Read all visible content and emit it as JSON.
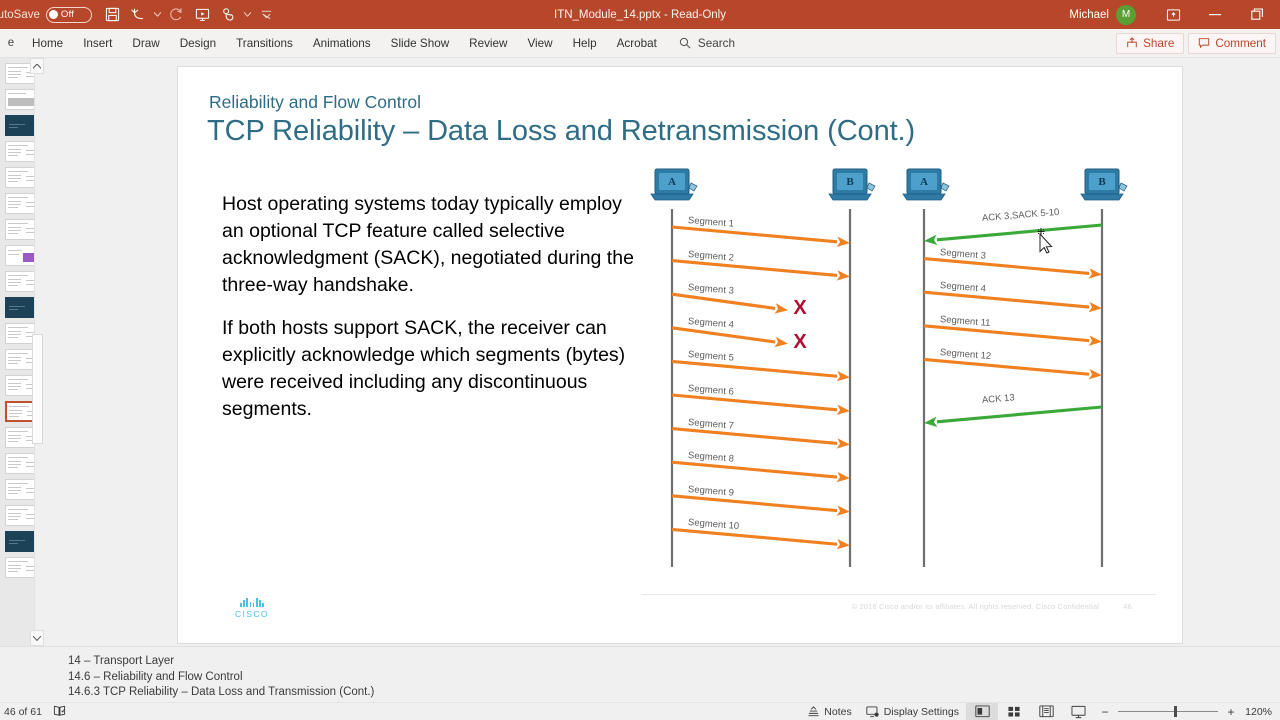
{
  "titlebar": {
    "autosave_label": "AutoSave",
    "autosave_state": "Off",
    "document_title": "ITN_Module_14.pptx  -  Read-Only",
    "user_name": "Michael",
    "avatar_initial": "M",
    "qat": [
      {
        "name": "save-icon",
        "label": "Save"
      },
      {
        "name": "undo-icon",
        "label": "Undo"
      },
      {
        "name": "redo-icon",
        "label": "Redo"
      },
      {
        "name": "start-presentation-icon",
        "label": "Start From Beginning"
      },
      {
        "name": "touch-mode-icon",
        "label": "Touch/Mouse Mode"
      },
      {
        "name": "customize-qat-icon",
        "label": "Customize Quick Access Toolbar"
      }
    ],
    "window_buttons": [
      {
        "name": "ribbon-display-options-icon",
        "label": "Ribbon Display Options"
      },
      {
        "name": "minimize-icon",
        "label": "Minimize"
      },
      {
        "name": "restore-icon",
        "label": "Restore Down"
      }
    ]
  },
  "ribbon": {
    "file_tab": "e",
    "tabs": [
      {
        "label": "Home",
        "active": true
      },
      {
        "label": "Insert",
        "active": false
      },
      {
        "label": "Draw",
        "active": false
      },
      {
        "label": "Design",
        "active": false
      },
      {
        "label": "Transitions",
        "active": false
      },
      {
        "label": "Animations",
        "active": false
      },
      {
        "label": "Slide Show",
        "active": false
      },
      {
        "label": "Review",
        "active": false
      },
      {
        "label": "View",
        "active": false
      },
      {
        "label": "Help",
        "active": false
      },
      {
        "label": "Acrobat",
        "active": false
      }
    ],
    "search_placeholder": "Search",
    "share_label": "Share",
    "comments_label": "Comment"
  },
  "slide": {
    "eyebrow": "Reliability and Flow Control",
    "title": "TCP Reliability – Data Loss and Retransmission (Cont.)",
    "paragraphs": [
      "Host operating systems today typically employ an optional TCP feature called selective acknowledgment (SACK), negotiated during the three-way handshake.",
      "If both hosts support SACK, the receiver can explicitly acknowledge which segments (bytes) were received including any discontinuous segments."
    ],
    "cisco_logo_word": "CISCO",
    "copyright": "© 2016  Cisco and/or its affiliates. All rights reserved.   Cisco Confidential",
    "page_number": "46",
    "colors": {
      "title": "#2f6c86",
      "segment_arrow": "#f08020",
      "ack_arrow": "#3aa93a",
      "loss_mark": "#b01030",
      "host_body": "#2e7ba6"
    },
    "diagram_left": {
      "host_a_label": "A",
      "host_b_label": "B",
      "messages": [
        {
          "label": "Segment 1",
          "dir": "right",
          "kind": "segment",
          "lost": false
        },
        {
          "label": "Segment 2",
          "dir": "right",
          "kind": "segment",
          "lost": false
        },
        {
          "label": "Segment 3",
          "dir": "right",
          "kind": "segment",
          "lost": true
        },
        {
          "label": "Segment 4",
          "dir": "right",
          "kind": "segment",
          "lost": true
        },
        {
          "label": "Segment 5",
          "dir": "right",
          "kind": "segment",
          "lost": false
        },
        {
          "label": "Segment 6",
          "dir": "right",
          "kind": "segment",
          "lost": false
        },
        {
          "label": "Segment 7",
          "dir": "right",
          "kind": "segment",
          "lost": false
        },
        {
          "label": "Segment 8",
          "dir": "right",
          "kind": "segment",
          "lost": false
        },
        {
          "label": "Segment 9",
          "dir": "right",
          "kind": "segment",
          "lost": false
        },
        {
          "label": "Segment 10",
          "dir": "right",
          "kind": "segment",
          "lost": false
        }
      ]
    },
    "diagram_right": {
      "host_a_label": "A",
      "host_b_label": "B",
      "messages": [
        {
          "label": "ACK 3,SACK 5-10",
          "dir": "left",
          "kind": "ack",
          "lost": false
        },
        {
          "label": "Segment 3",
          "dir": "right",
          "kind": "segment",
          "lost": false
        },
        {
          "label": "Segment 4",
          "dir": "right",
          "kind": "segment",
          "lost": false
        },
        {
          "label": "Segment 11",
          "dir": "right",
          "kind": "segment",
          "lost": false
        },
        {
          "label": "Segment 12",
          "dir": "right",
          "kind": "segment",
          "lost": false
        },
        {
          "label": "ACK 13",
          "dir": "left",
          "kind": "ack",
          "lost": false
        }
      ]
    }
  },
  "notes": {
    "lines": [
      "14 – Transport Layer",
      "14.6 – Reliability and Flow Control",
      "14.6.3 TCP Reliability – Data Loss and Transmission (Cont.)"
    ]
  },
  "statusbar": {
    "slide_counter": "46 of 61",
    "accessibility_label": "Accessibility Checker",
    "notes_label": "Notes",
    "display_settings_label": "Display Settings",
    "views": [
      {
        "name": "normal-view-button",
        "active": true
      },
      {
        "name": "slide-sorter-view-button",
        "active": false
      },
      {
        "name": "reading-view-button",
        "active": false
      },
      {
        "name": "slide-show-button",
        "active": false
      }
    ],
    "zoom_out": "−",
    "zoom_in": "+",
    "zoom_level": "120%"
  },
  "thumbnails": [
    {
      "index": 1,
      "style": "text",
      "selected": false
    },
    {
      "index": 2,
      "style": "bars",
      "selected": false
    },
    {
      "index": 3,
      "style": "dark",
      "selected": false
    },
    {
      "index": 4,
      "style": "text",
      "selected": false
    },
    {
      "index": 5,
      "style": "text",
      "selected": false
    },
    {
      "index": 6,
      "style": "text",
      "selected": false
    },
    {
      "index": 7,
      "style": "text",
      "selected": false
    },
    {
      "index": 8,
      "style": "purple",
      "selected": false
    },
    {
      "index": 9,
      "style": "text",
      "selected": false
    },
    {
      "index": 10,
      "style": "dark",
      "selected": false
    },
    {
      "index": 11,
      "style": "text",
      "selected": false
    },
    {
      "index": 12,
      "style": "text",
      "selected": false
    },
    {
      "index": 13,
      "style": "text",
      "selected": false
    },
    {
      "index": 14,
      "style": "text",
      "selected": true
    },
    {
      "index": 15,
      "style": "text",
      "selected": false
    },
    {
      "index": 16,
      "style": "text",
      "selected": false
    },
    {
      "index": 17,
      "style": "text",
      "selected": false
    },
    {
      "index": 18,
      "style": "text",
      "selected": false
    },
    {
      "index": 19,
      "style": "dark",
      "selected": false
    },
    {
      "index": 20,
      "style": "text",
      "selected": false
    }
  ]
}
